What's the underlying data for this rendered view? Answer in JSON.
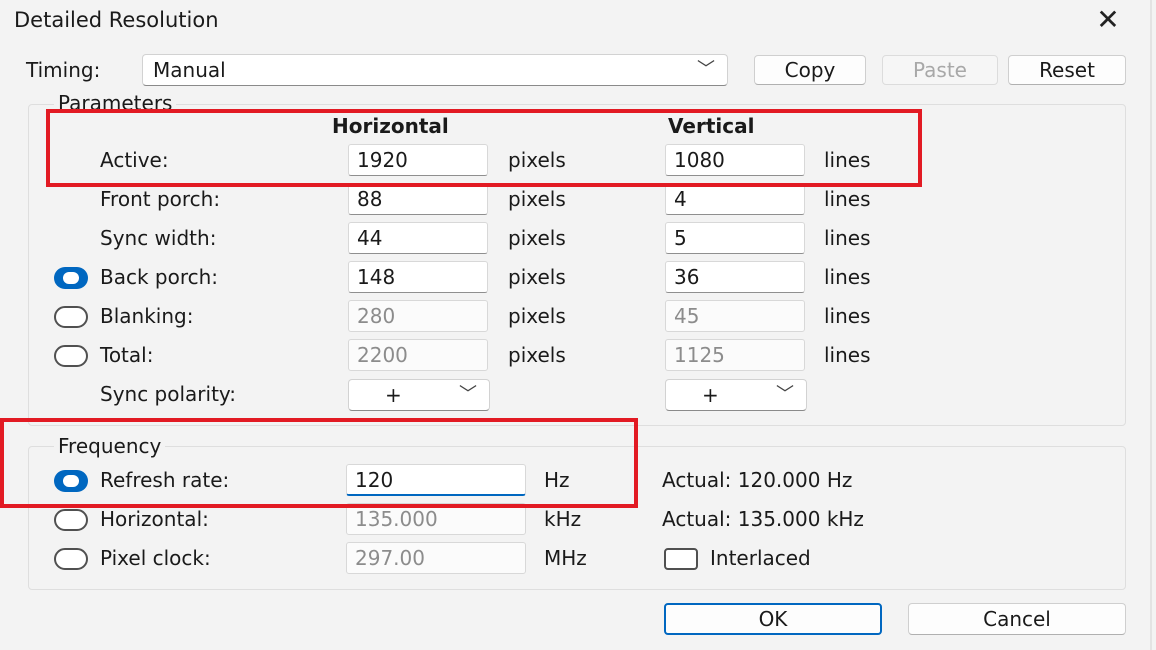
{
  "window": {
    "title": "Detailed Resolution",
    "close_glyph": "✕"
  },
  "timing": {
    "label": "Timing:",
    "value": "Manual"
  },
  "buttons": {
    "copy": "Copy",
    "paste": "Paste",
    "reset": "Reset",
    "ok": "OK",
    "cancel": "Cancel"
  },
  "parameters": {
    "group_title": "Parameters",
    "horizontal_header": "Horizontal",
    "vertical_header": "Vertical",
    "h_unit": "pixels",
    "v_unit": "lines",
    "rows": {
      "active": {
        "label": "Active:",
        "h": "1920",
        "v": "1080"
      },
      "front_porch": {
        "label": "Front porch:",
        "h": "88",
        "v": "4"
      },
      "sync_width": {
        "label": "Sync width:",
        "h": "44",
        "v": "5"
      },
      "back_porch": {
        "label": "Back porch:",
        "h": "148",
        "v": "36",
        "selected": true
      },
      "blanking": {
        "label": "Blanking:",
        "h": "280",
        "v": "45",
        "selected": false
      },
      "total": {
        "label": "Total:",
        "h": "2200",
        "v": "1125",
        "selected": false
      }
    },
    "sync_polarity": {
      "label": "Sync polarity:",
      "h": "+",
      "v": "+"
    }
  },
  "frequency": {
    "group_title": "Frequency",
    "refresh": {
      "label": "Refresh rate:",
      "value": "120",
      "unit": "Hz",
      "actual": "Actual: 120.000 Hz",
      "selected": true
    },
    "horizontal": {
      "label": "Horizontal:",
      "value": "135.000",
      "unit": "kHz",
      "actual": "Actual: 135.000 kHz",
      "selected": false
    },
    "pixel_clock": {
      "label": "Pixel clock:",
      "value": "297.00",
      "unit": "MHz",
      "selected": false
    },
    "interlaced": {
      "label": "Interlaced",
      "checked": false
    }
  },
  "colors": {
    "accent": "#0067c0",
    "highlight": "#e21a23",
    "background": "#f3f3f3"
  }
}
